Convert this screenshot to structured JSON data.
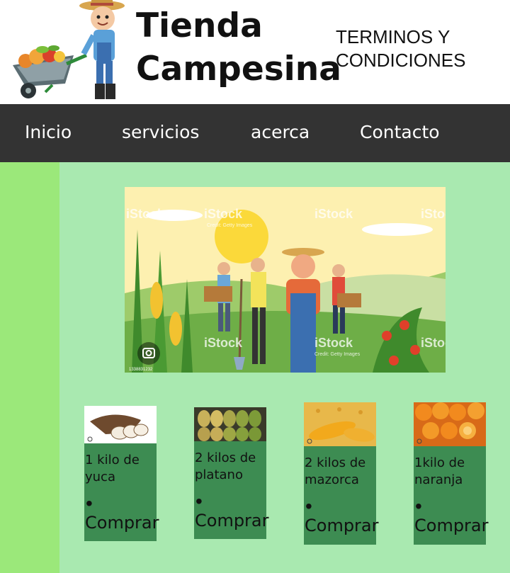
{
  "header": {
    "title_line1": "Tienda",
    "title_line2": "Campesina",
    "terms_line1": "TERMINOS Y",
    "terms_line2": "CONDICIONES"
  },
  "nav": {
    "items": [
      {
        "label": "Inicio"
      },
      {
        "label": "servicios"
      },
      {
        "label": "acerca"
      },
      {
        "label": "Contacto"
      }
    ]
  },
  "hero": {
    "watermark": "iStock",
    "watermark_sub": "Credit: Getty Images",
    "image_code": "1338831232"
  },
  "products": [
    {
      "title": "1 kilo de yuca",
      "bullet": "•",
      "buy_label": "Comprar"
    },
    {
      "title": "2 kilos de platano",
      "bullet": "•",
      "buy_label": "Comprar"
    },
    {
      "title": "2 kilos de mazorca",
      "bullet": "•",
      "buy_label": "Comprar"
    },
    {
      "title": "1kilo de naranja",
      "bullet": "•",
      "buy_label": "Comprar"
    }
  ],
  "colors": {
    "nav_bg": "#333333",
    "sidebar_bg": "#9be87a",
    "main_bg": "#a9e9b0",
    "card_bg": "#3d8c52"
  }
}
